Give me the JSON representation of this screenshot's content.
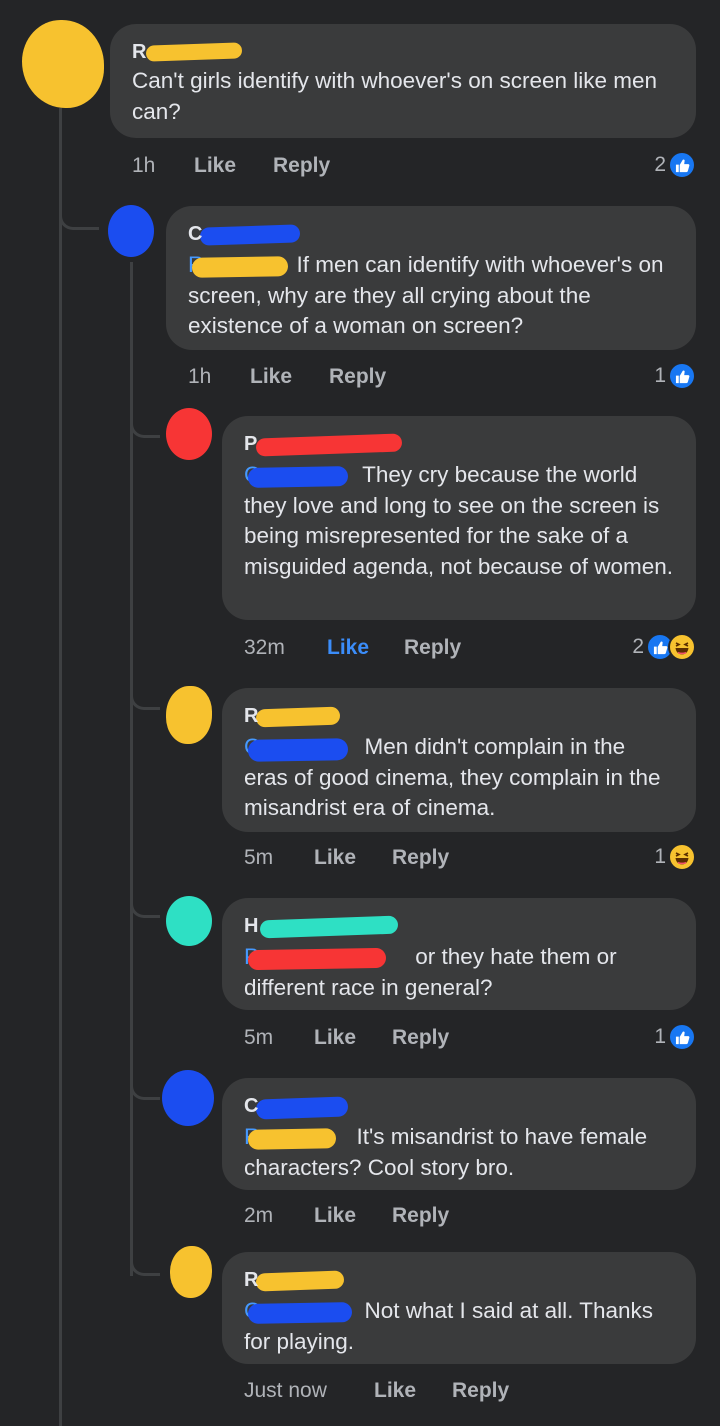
{
  "colors": {
    "background": "#242527",
    "bubble": "#3a3b3c",
    "tag_blue": "#4599ff",
    "like_blue": "#1877f2",
    "scribble_yellow": "#f7c22f",
    "scribble_blue": "#1b4df0",
    "scribble_red": "#f73535",
    "scribble_teal": "#2ee0c4"
  },
  "labels": {
    "like": "Like",
    "reply": "Reply"
  },
  "comments": [
    {
      "author_initial": "R",
      "text": "Can't girls identify with whoever's on screen like men can?",
      "time": "1h",
      "reaction_count": "2",
      "reactions": [
        "like"
      ],
      "avatar_color": "yellow"
    },
    {
      "author_initial": "C",
      "tag_initial": "R",
      "text": " If men can identify with whoever's on screen, why are they all crying about the existence of a woman on screen?",
      "time": "1h",
      "reaction_count": "1",
      "reactions": [
        "like"
      ],
      "avatar_color": "blue"
    },
    {
      "author_initial": "P",
      "tag_initial": "C",
      "text": " They cry because the world they love and long to see on the screen is being misrepresented for the sake of a misguided agenda, not because of women.",
      "time": "32m",
      "liked_by_viewer": true,
      "reaction_count": "2",
      "reactions": [
        "like",
        "haha"
      ],
      "avatar_color": "red"
    },
    {
      "author_initial": "R",
      "tag_initial": "C",
      "text": " Men didn't complain in the eras of good cinema, they complain in the misandrist era of cinema.",
      "time": "5m",
      "reaction_count": "1",
      "reactions": [
        "haha"
      ],
      "avatar_color": "yellow"
    },
    {
      "author_initial": "H",
      "tag_initial": "P",
      "text": " or they hate them or different race in general?",
      "time": "5m",
      "reaction_count": "1",
      "reactions": [
        "like"
      ],
      "avatar_color": "teal"
    },
    {
      "author_initial": "C",
      "tag_initial": "R",
      "text": " It's misandrist to have female characters? Cool story bro.",
      "time": "2m",
      "reaction_count": "",
      "reactions": [],
      "avatar_color": "blue"
    },
    {
      "author_initial": "R",
      "tag_initial": "C",
      "text": " Not what I said at all. Thanks for playing.",
      "time": "Just now",
      "reaction_count": "",
      "reactions": [],
      "avatar_color": "yellow"
    }
  ]
}
